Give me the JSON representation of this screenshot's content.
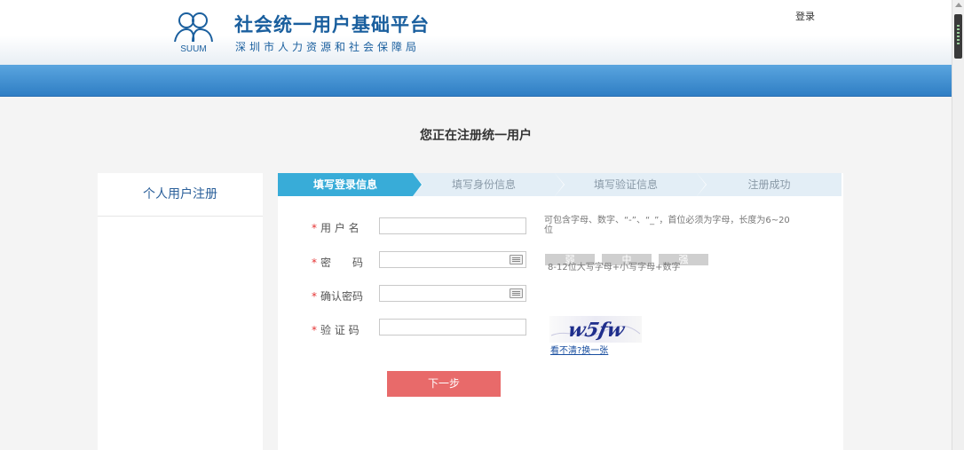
{
  "header": {
    "logo_mark": "SUUM",
    "title": "社会统一用户基础平台",
    "subtitle": "深圳市人力资源和社会保障局",
    "login_link": "登录"
  },
  "page_heading": "您正在注册统一用户",
  "sidebar": {
    "items": [
      {
        "label": "个人用户注册"
      }
    ]
  },
  "steps": [
    {
      "label": "填写登录信息",
      "active": true
    },
    {
      "label": "填写身份信息",
      "active": false
    },
    {
      "label": "填写验证信息",
      "active": false
    },
    {
      "label": "注册成功",
      "active": false
    }
  ],
  "form": {
    "required_mark": "*",
    "username": {
      "label": "用 户 名",
      "value": "",
      "hint_line1": "可包含字母、数字、“-”、“_”，首位必须为字母，长度为6~20",
      "hint_line2": "位"
    },
    "password": {
      "label": "密　　码",
      "value": "",
      "hint": "8-12位大写字母+小写字母+数字"
    },
    "confirm_password": {
      "label": "确认密码",
      "value": ""
    },
    "captcha": {
      "label": "验 证 码",
      "value": "",
      "image_text": "w5fw",
      "refresh_link": "看不清?换一张"
    }
  },
  "strength_levels": [
    "弱",
    "中",
    "强"
  ],
  "next_button": "下一步",
  "colors": {
    "brand_blue": "#1a5f9e",
    "bar_blue": "#2f7ec4",
    "step_active": "#38acd8",
    "button_red": "#e86a6a",
    "required_red": "#e53333"
  }
}
